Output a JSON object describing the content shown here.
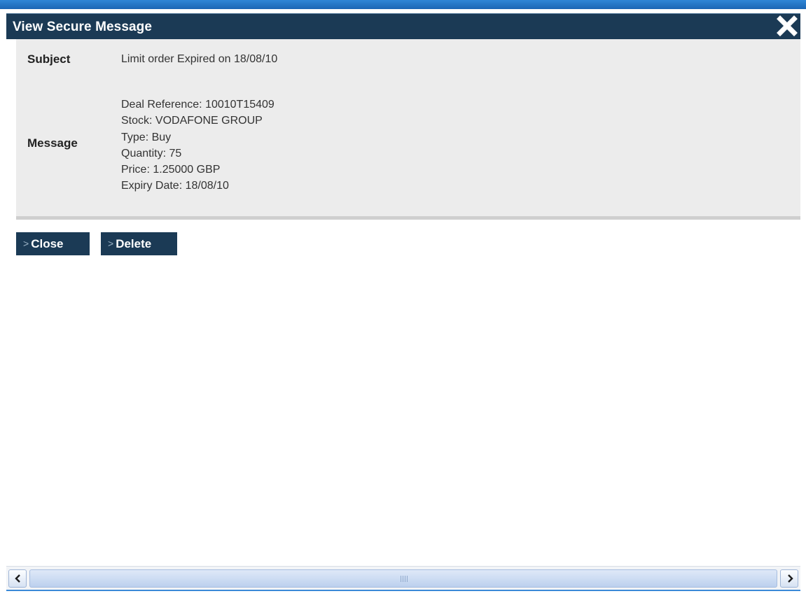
{
  "window": {
    "title": "View Secure Message",
    "close_icon": "close-icon"
  },
  "message": {
    "subject_label": "Subject",
    "subject_value": "Limit order Expired on 18/08/10",
    "message_label": "Message",
    "lines": [
      "Deal Reference: 10010T15409",
      "Stock: VODAFONE GROUP",
      "Type: Buy",
      "Quantity: 75",
      "Price: 1.25000 GBP",
      "Expiry Date: 18/08/10"
    ]
  },
  "actions": {
    "chevron": ">",
    "close_label": "Close",
    "delete_label": "Delete"
  },
  "scrollbar": {
    "left_icon": "chevron-left-icon",
    "right_icon": "chevron-right-icon",
    "grip_icon": "grip-icon"
  },
  "colors": {
    "titlebar": "#1b3a55",
    "panel": "#ececec",
    "accent": "#2f86d6"
  }
}
